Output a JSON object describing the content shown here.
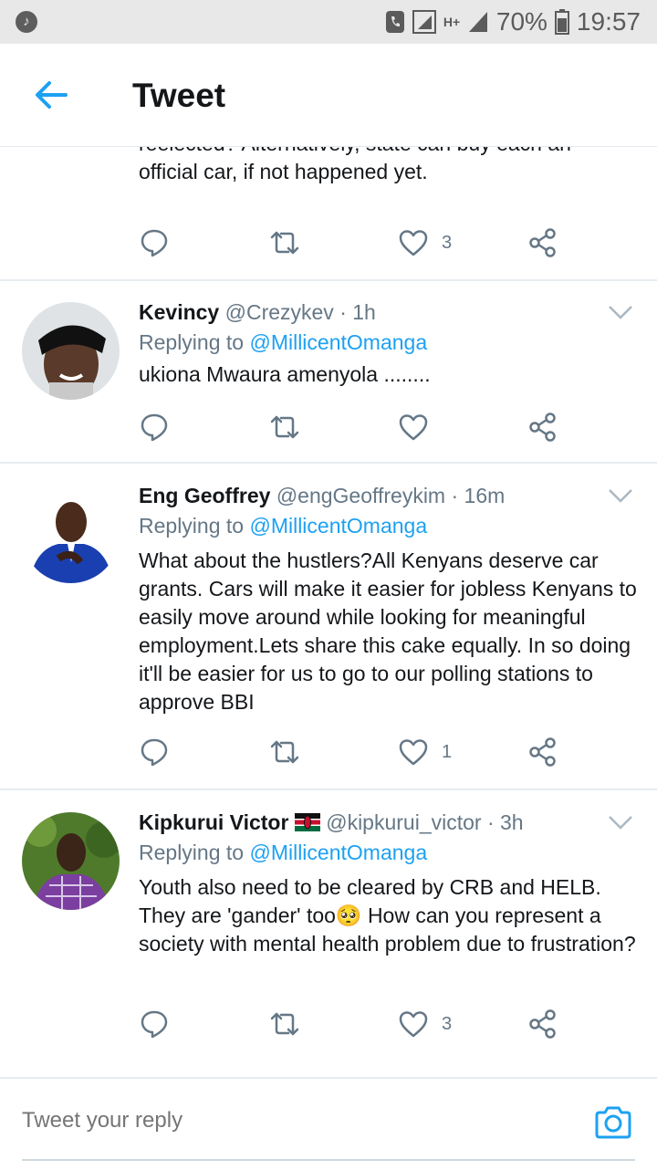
{
  "status_bar": {
    "battery": "70%",
    "time": "19:57",
    "network": "H+"
  },
  "header": {
    "title": "Tweet"
  },
  "top_tweet": {
    "text_lines": [
      "reelected? Alternatively, state can buy each an",
      "official car, if not happened yet."
    ],
    "likes": "3"
  },
  "replies": [
    {
      "name": "Kevincy",
      "handle": "@Crezykev",
      "time": "1h",
      "replying_prefix": "Replying to",
      "replying_to": "@MillicentOmanga",
      "text": "ukiona Mwaura amenyola ........",
      "likes": ""
    },
    {
      "name": "Eng Geoffrey",
      "handle": "@engGeoffreykim",
      "time": "16m",
      "replying_prefix": "Replying to",
      "replying_to": "@MillicentOmanga",
      "text": "What about the hustlers?All Kenyans deserve car grants. Cars will make it easier for jobless Kenyans to easily move around while looking for meaningful employment.Lets share this cake equally. In so doing it'll be easier for us to go to our polling stations to approve BBI",
      "likes": "1"
    },
    {
      "name": "Kipkurui Victor",
      "handle": "@kipkurui_victor",
      "time": "3h",
      "replying_prefix": "Replying to",
      "replying_to": "@MillicentOmanga",
      "text": "Youth also need to be cleared by CRB and HELB. They are 'gander' too🥺 How can you represent a society with mental health problem due to frustration?",
      "likes": "3"
    }
  ],
  "composer": {
    "placeholder": "Tweet your reply"
  },
  "icons": {
    "back": "arrow-left-icon",
    "reply": "reply-icon",
    "retweet": "retweet-icon",
    "like": "heart-icon",
    "share": "share-icon",
    "more": "chevron-down-icon",
    "camera": "camera-icon",
    "flag": "kenya-flag-icon"
  },
  "colors": {
    "accent": "#1da1f2",
    "muted": "#657786",
    "text": "#14171a"
  }
}
